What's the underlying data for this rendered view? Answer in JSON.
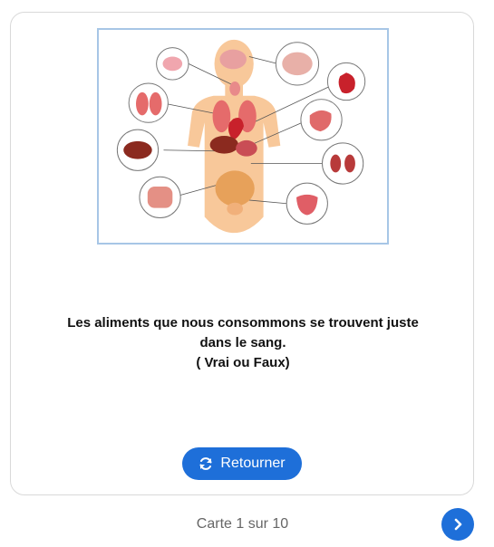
{
  "card": {
    "question_line1": "Les aliments que nous consommons se trouvent juste",
    "question_line2": "dans le sang.",
    "question_line3": "( Vrai ou Faux)",
    "illustration_icon": "human-organs-diagram"
  },
  "actions": {
    "flip_label": "Retourner",
    "flip_icon": "refresh-icon",
    "next_icon": "chevron-right-icon"
  },
  "navigation": {
    "counter_text": "Carte 1 sur 10"
  },
  "colors": {
    "accent": "#1e6fd9",
    "card_border": "#d9d9d9",
    "image_border": "#a7c6e6",
    "counter_text": "#666666"
  }
}
